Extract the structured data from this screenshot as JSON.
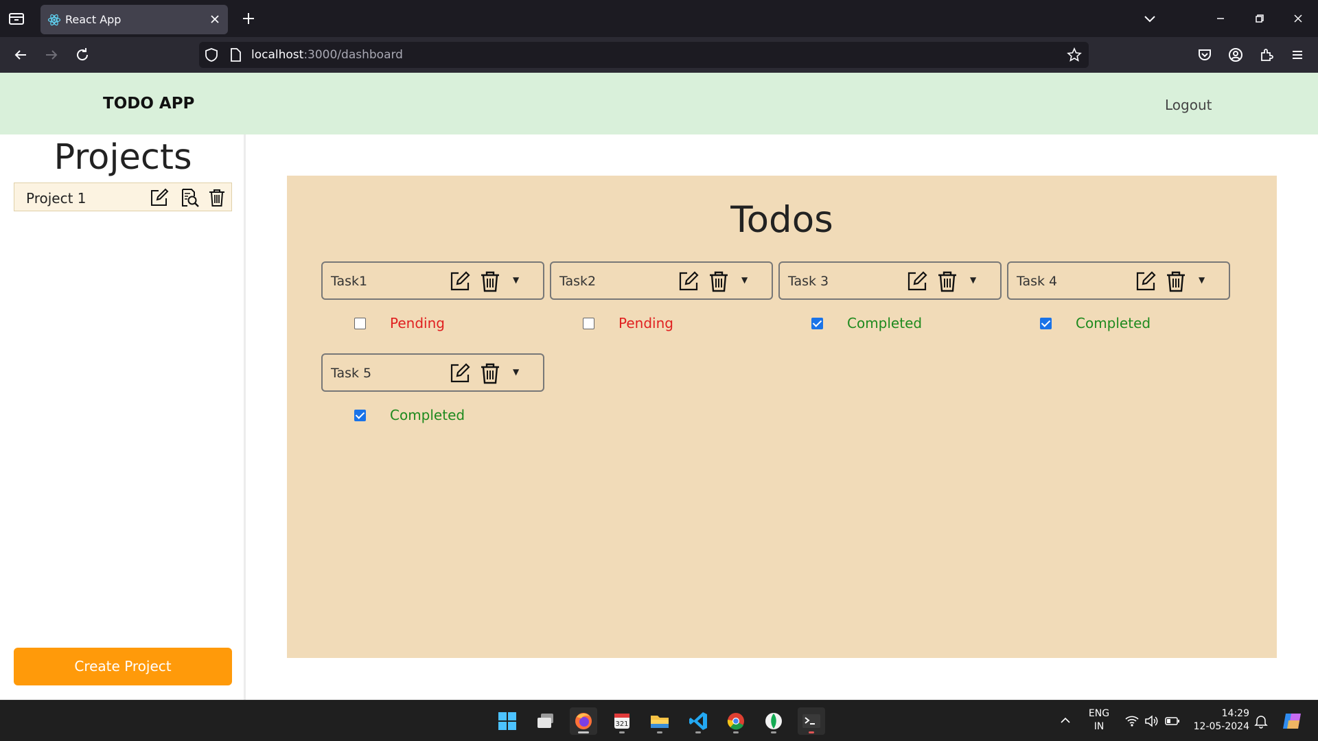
{
  "browser": {
    "tab_title": "React App",
    "url_host": "localhost",
    "url_path": ":3000/dashboard"
  },
  "app": {
    "brand": "TODO APP",
    "logout_label": "Logout"
  },
  "sidebar": {
    "title": "Projects",
    "projects": [
      {
        "name": "Project 1"
      }
    ],
    "create_label": "Create Project"
  },
  "main": {
    "title": "Todos",
    "tasks": [
      {
        "name": "Task1",
        "status": "Pending",
        "checked": false
      },
      {
        "name": "Task2",
        "status": "Pending",
        "checked": false
      },
      {
        "name": "Task 3",
        "status": "Completed",
        "checked": true
      },
      {
        "name": "Task 4",
        "status": "Completed",
        "checked": true
      },
      {
        "name": "Task 5",
        "status": "Completed",
        "checked": true
      }
    ]
  },
  "colors": {
    "header_bg": "#d9f0da",
    "panel_bg": "#f1dbb8",
    "accent": "#ff9a0a",
    "pending": "#e02020",
    "completed": "#1e8a1e"
  },
  "taskbar": {
    "lang_top": "ENG",
    "lang_bottom": "IN",
    "time": "14:29",
    "date": "12-05-2024"
  }
}
